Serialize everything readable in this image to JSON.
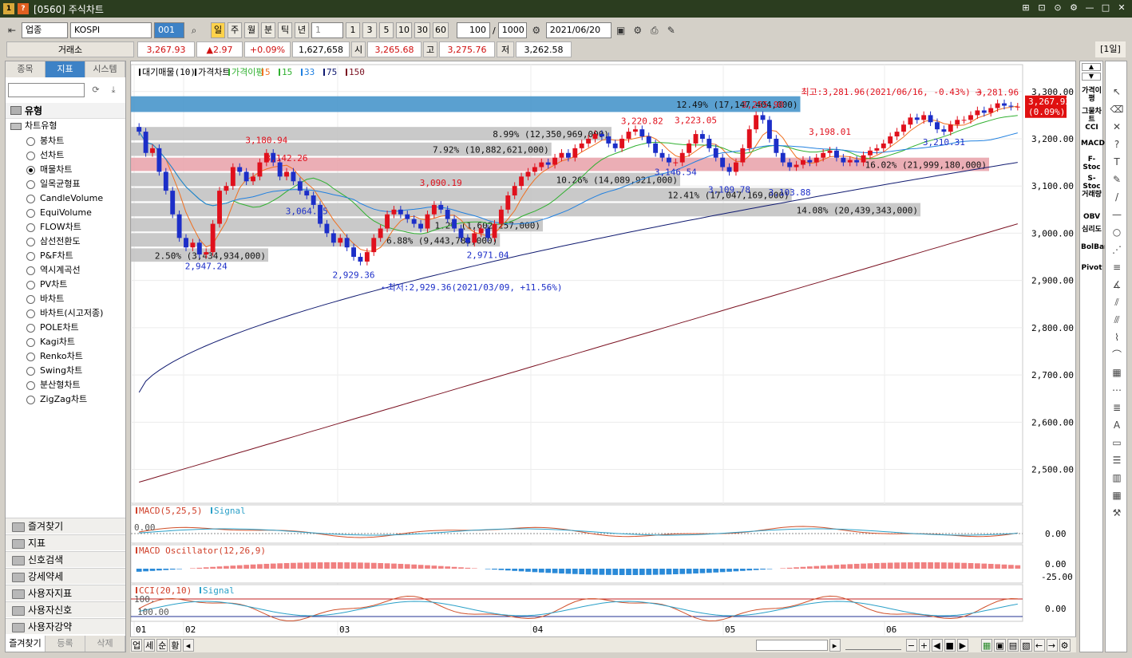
{
  "window": {
    "badge": "1",
    "badge2": "?",
    "title": "[0560] 주식차트",
    "controls": [
      "⊞",
      "⊡",
      "⊙",
      "⚙",
      "—",
      "□",
      "✕"
    ]
  },
  "toolbar": {
    "market": "업종",
    "symbol": "KOSPI",
    "code": "001",
    "periods": [
      "일",
      "주",
      "월",
      "분",
      "틱",
      "년"
    ],
    "interval": "1",
    "quick": [
      "1",
      "3",
      "5",
      "10",
      "30",
      "60"
    ],
    "count": "100",
    "slash": "/",
    "total": "1000",
    "date": "2021/06/20"
  },
  "quote": {
    "exchange": "거래소",
    "price": "3,267.93",
    "change": "▲2.97",
    "change_pct": "+0.09%",
    "volume": "1,627,658",
    "open_label": "시",
    "open": "3,265.68",
    "high_label": "고",
    "high": "3,275.76",
    "low_label": "저",
    "low": "3,262.58",
    "period_tag": "[1일]"
  },
  "left_panel": {
    "tabs": [
      "종목",
      "지표",
      "시스템"
    ],
    "header": "유형",
    "group": "차트유형",
    "items": [
      "봉차트",
      "선차트",
      "매물차트",
      "일목균형표",
      "CandleVolume",
      "EquiVolume",
      "FLOW차트",
      "삼선전환도",
      "P&F차트",
      "역시계곡선",
      "PV차트",
      "바차트",
      "바차트(시고저종)",
      "POLE차트",
      "Kagi차트",
      "Renko차트",
      "Swing차트",
      "분산형차트",
      "ZigZag차트"
    ],
    "selected": 2,
    "folders": [
      "즐겨찾기",
      "지표",
      "신호검색",
      "강세약세",
      "사용자지표",
      "사용자신호",
      "사용자강약"
    ],
    "bottom_tabs": [
      "즐겨찾기",
      "등록",
      "삭제"
    ]
  },
  "right_indicators": [
    "가격이평",
    "그물차트",
    "CCI",
    "MACD",
    "F-Stoc",
    "S-Stoc",
    "거래량",
    "OBV",
    "심리도",
    "BolBand",
    "Pivot"
  ],
  "colors": {
    "up": "#e0101c",
    "down": "#1c2ec8",
    "ma5": "#f07020",
    "ma15": "#30b030",
    "ma33": "#2080e0",
    "ma75": "#101a70",
    "ma150": "#7a1020",
    "profile": "#c0c0c0",
    "profile_max": "#3d8fc8",
    "profile_cur": "#e8a0a8"
  },
  "chart_data": [
    {
      "type": "candlestick",
      "legend": [
        "대기매물(10)",
        "가격차트",
        "가격이평",
        "5",
        "15",
        "33",
        "75",
        "150"
      ],
      "x_labels": [
        "01",
        "02",
        "03",
        "04",
        "05",
        "06"
      ],
      "y_ticks": [
        2500,
        2600,
        2700,
        2800,
        2900,
        3000,
        3100,
        3200,
        3300
      ],
      "y_tick_labels": [
        "2,500.00",
        "2,600.00",
        "2,700.00",
        "2,800.00",
        "2,900.00",
        "3,000.00",
        "3,100.00",
        "3,200.00",
        "3,300.00"
      ],
      "ylim": [
        2430,
        3330
      ],
      "current_price_label": [
        "3,267.93",
        "(0.09%)"
      ],
      "annotations": {
        "max": "최고:3,281.96(2021/06/16, -0.43%)",
        "min": "최저:2,929.36(2021/03/09, +11.56%)",
        "points": [
          {
            "i": 32,
            "v": 2929.36,
            "label": "2,929.36",
            "c": "down"
          },
          {
            "i": 10,
            "v": 2947.24,
            "label": "2,947.24",
            "c": "down"
          },
          {
            "i": 25,
            "v": 3064.25,
            "label": "3,064.25",
            "c": "down"
          },
          {
            "i": 22,
            "v": 3142.26,
            "label": "3,142.26",
            "c": "up"
          },
          {
            "i": 19,
            "v": 3180.94,
            "label": "3,180.94",
            "c": "up"
          },
          {
            "i": 45,
            "v": 3090.19,
            "label": "3,090.19",
            "c": "up"
          },
          {
            "i": 52,
            "v": 2971.04,
            "label": "2,971.04",
            "c": "down"
          },
          {
            "i": 75,
            "v": 3220.82,
            "label": "3,220.82",
            "c": "up"
          },
          {
            "i": 83,
            "v": 3223.05,
            "label": "3,223.05",
            "c": "up"
          },
          {
            "i": 80,
            "v": 3146.54,
            "label": "3,146.54",
            "c": "down"
          },
          {
            "i": 88,
            "v": 3109.78,
            "label": "3,109.78",
            "c": "down"
          },
          {
            "i": 93,
            "v": 3255.9,
            "label": "3,255.90",
            "c": "up"
          },
          {
            "i": 97,
            "v": 3103.88,
            "label": "3,103.88",
            "c": "down"
          },
          {
            "i": 103,
            "v": 3198.01,
            "label": "3,198.01",
            "c": "up"
          },
          {
            "i": 120,
            "v": 3210.31,
            "label": "3,210.31",
            "c": "down"
          },
          {
            "i": 128,
            "v": 3281.96,
            "label": "3,281.96",
            "c": "up"
          }
        ]
      },
      "volume_profile": [
        {
          "lo": 3130,
          "hi": 3160,
          "pct_label": "16.02% (21,999,180,000)",
          "len": 1.0,
          "kind": "cur"
        },
        {
          "lo": 3255,
          "hi": 3290,
          "pct_label": "12.49% (17,147,404,000)",
          "len": 0.78,
          "kind": "max"
        },
        {
          "lo": 3195,
          "hi": 3225,
          "pct_label": "8.99% (12,350,969,000)",
          "len": 0.56,
          "kind": "n"
        },
        {
          "lo": 3162,
          "hi": 3192,
          "pct_label": "7.92% (10,882,621,000)",
          "len": 0.49,
          "kind": "n"
        },
        {
          "lo": 3098,
          "hi": 3128,
          "pct_label": "10.26% (14,089,921,000)",
          "len": 0.64,
          "kind": "n"
        },
        {
          "lo": 3066,
          "hi": 3096,
          "pct_label": "12.41% (17,047,169,000)",
          "len": 0.77,
          "kind": "n"
        },
        {
          "lo": 3034,
          "hi": 3064,
          "pct_label": "14.08% (20,439,343,000)",
          "len": 0.92,
          "kind": "n"
        },
        {
          "lo": 3002,
          "hi": 3032,
          "pct_label": "1.2% (1,602,257,000)",
          "len": 0.48,
          "kind": "n"
        },
        {
          "lo": 2970,
          "hi": 3000,
          "pct_label": "6.88% (9,443,783,000)",
          "len": 0.43,
          "kind": "n"
        },
        {
          "lo": 2938,
          "hi": 2968,
          "pct_label": "2.50% (3,434,934,000)",
          "len": 0.16,
          "kind": "n"
        }
      ],
      "close": [
        3215,
        3170,
        3180,
        3130,
        3090,
        3040,
        2990,
        2970,
        2980,
        2955,
        2960,
        3020,
        3090,
        3100,
        3140,
        3130,
        3110,
        3120,
        3150,
        3170,
        3150,
        3120,
        3130,
        3110,
        3090,
        3080,
        3060,
        3020,
        3000,
        2980,
        2990,
        2970,
        2950,
        2940,
        2960,
        2990,
        3010,
        3040,
        3050,
        3040,
        3030,
        3020,
        3010,
        3040,
        3060,
        3050,
        3030,
        3010,
        2990,
        2980,
        3000,
        3010,
        2990,
        3020,
        3050,
        3080,
        3100,
        3120,
        3130,
        3140,
        3150,
        3145,
        3160,
        3170,
        3160,
        3180,
        3190,
        3200,
        3210,
        3205,
        3190,
        3180,
        3200,
        3215,
        3220,
        3205,
        3190,
        3170,
        3160,
        3150,
        3150,
        3170,
        3190,
        3210,
        3200,
        3180,
        3160,
        3140,
        3130,
        3150,
        3180,
        3220,
        3250,
        3240,
        3200,
        3170,
        3150,
        3140,
        3145,
        3155,
        3150,
        3160,
        3170,
        3175,
        3160,
        3150,
        3155,
        3150,
        3165,
        3175,
        3180,
        3190,
        3205,
        3215,
        3230,
        3245,
        3240,
        3250,
        3235,
        3220,
        3215,
        3230,
        3240,
        3240,
        3250,
        3260,
        3255,
        3265,
        3275,
        3270,
        3268,
        3268
      ]
    },
    {
      "type": "line",
      "legend": [
        "MACD(5,25,5)",
        "Signal"
      ],
      "y_tick_labels": [
        "0.00"
      ],
      "left_label": "0.00"
    },
    {
      "type": "bar",
      "legend": [
        "MACD Oscillator(12,26,9)"
      ],
      "y_tick_labels": [
        "0.00",
        "-25.00"
      ]
    },
    {
      "type": "line",
      "legend": [
        "CCI(20,10)",
        "Signal"
      ],
      "y_tick_labels": [
        "0.00"
      ],
      "left_labels": [
        "100.",
        "100.00"
      ]
    }
  ],
  "bottombar": {
    "labels": [
      "업",
      "세",
      "순",
      "황"
    ]
  }
}
